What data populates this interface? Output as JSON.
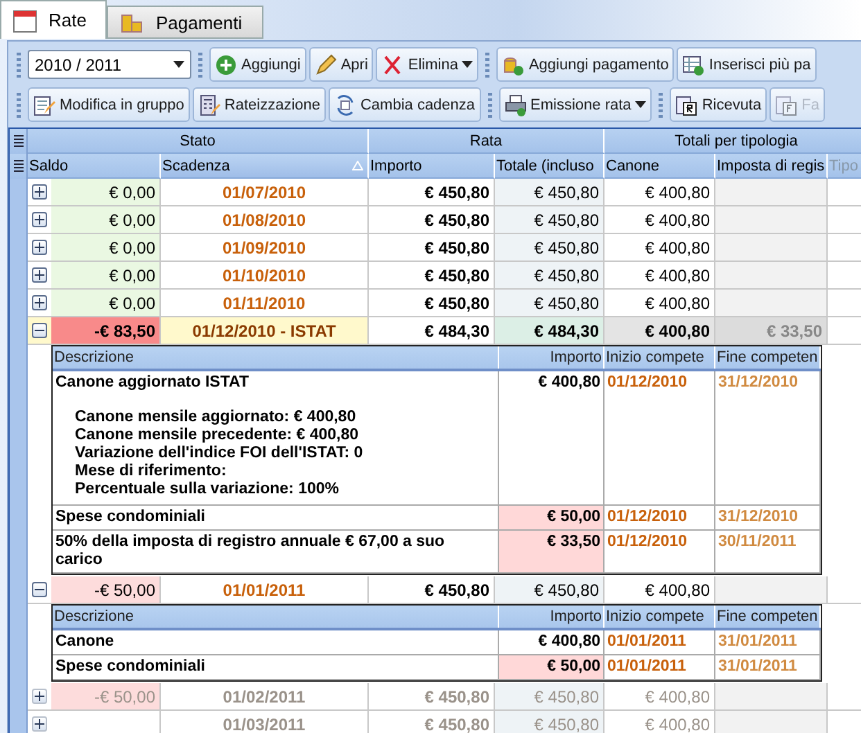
{
  "tabs": [
    {
      "label": "Rate",
      "selected": true
    },
    {
      "label": "Pagamenti",
      "selected": false
    }
  ],
  "toolbars": [
    [
      {
        "kind": "dropdown",
        "label": "2010 / 2011"
      },
      {
        "kind": "separator"
      },
      {
        "kind": "button",
        "label": "Aggiungi"
      },
      {
        "kind": "button",
        "label": "Apri"
      },
      {
        "kind": "split",
        "label": "Elimina"
      },
      {
        "kind": "separator"
      },
      {
        "kind": "button",
        "label": "Aggiungi pagamento"
      },
      {
        "kind": "button",
        "label": "Inserisci più pa"
      }
    ],
    [
      {
        "kind": "button",
        "label": "Modifica in gruppo"
      },
      {
        "kind": "button",
        "label": "Rateizzazione"
      },
      {
        "kind": "button",
        "label": "Cambia cadenza"
      },
      {
        "kind": "separator"
      },
      {
        "kind": "split",
        "label": "Emissione rata"
      },
      {
        "kind": "separator"
      },
      {
        "kind": "button",
        "label": "Ricevuta"
      },
      {
        "kind": "disabled",
        "label": "Fa"
      }
    ]
  ],
  "grid": {
    "groups": [
      {
        "label": "Stato",
        "columns": [
          {
            "label": "Saldo",
            "sorted": false
          },
          {
            "label": "Scadenza",
            "sorted": true
          }
        ]
      },
      {
        "label": "Rata",
        "columns": [
          {
            "label": "Importo",
            "sorted": false
          },
          {
            "label": "Totale (incluso",
            "sorted": false
          }
        ]
      },
      {
        "label": "Totali per tipologia",
        "columns": [
          {
            "label": "Canone",
            "sorted": false
          },
          {
            "label": "Imposta di regis",
            "sorted": false
          },
          {
            "label": "Tipo",
            "sorted": false
          }
        ]
      }
    ],
    "rows": [
      {
        "expanded": false,
        "selected": false,
        "dimmed": false,
        "color": "#eaf8e2",
        "saldo": "€ 0,00",
        "scadenza": "01/07/2010",
        "importo": "€ 450,80",
        "totale": "€ 450,80",
        "canone": "€ 400,80"
      },
      {
        "expanded": false,
        "selected": false,
        "dimmed": false,
        "color": "#eaf8e2",
        "saldo": "€ 0,00",
        "scadenza": "01/08/2010",
        "importo": "€ 450,80",
        "totale": "€ 450,80",
        "canone": "€ 400,80"
      },
      {
        "expanded": false,
        "selected": false,
        "dimmed": false,
        "color": "#eaf8e2",
        "saldo": "€ 0,00",
        "scadenza": "01/09/2010",
        "importo": "€ 450,80",
        "totale": "€ 450,80",
        "canone": "€ 400,80"
      },
      {
        "expanded": false,
        "selected": false,
        "dimmed": false,
        "color": "#eaf8e2",
        "saldo": "€ 0,00",
        "scadenza": "01/10/2010",
        "importo": "€ 450,80",
        "totale": "€ 450,80",
        "canone": "€ 400,80"
      },
      {
        "expanded": false,
        "selected": false,
        "dimmed": false,
        "color": "#eaf8e2",
        "saldo": "€ 0,00",
        "scadenza": "01/11/2010",
        "importo": "€ 450,80",
        "totale": "€ 450,80",
        "canone": "€ 400,80"
      },
      {
        "expanded": true,
        "selected": true,
        "dimmed": false,
        "color": "#f88a8a",
        "saldo": "-€ 83,50",
        "scadenza": "01/12/2010 - ISTAT",
        "importo": "€ 484,30",
        "totale": "€ 484,30",
        "canone": "€ 400,80",
        "imposta": "€ 33,50",
        "details": {
          "columns": [
            "Descrizione",
            "Importo",
            "Inizio compete",
            "Fine competen"
          ],
          "items": [
            {
              "descrizione": "Canone aggiornato ISTAT",
              "notes": [
                "Canone mensile aggiornato: € 400,80",
                "Canone mensile precedente: € 400,80",
                "Variazione dell'indice FOI dell'ISTAT: 0",
                "Mese di riferimento:",
                "Percentuale sulla variazione: 100%"
              ],
              "importo": "€ 400,80",
              "flagged": false,
              "inizio": "01/12/2010",
              "fine": "31/12/2010"
            },
            {
              "descrizione": "Spese condominiali",
              "importo": "€ 50,00",
              "flagged": true,
              "inizio": "01/12/2010",
              "fine": "31/12/2010"
            },
            {
              "descrizione": "50% della imposta di registro annuale € 67,00 a suo carico",
              "importo": "€ 33,50",
              "flagged": true,
              "inizio": "01/12/2010",
              "fine": "30/11/2011"
            }
          ]
        }
      },
      {
        "expanded": true,
        "selected": false,
        "dimmed": false,
        "color": "#fddcdc",
        "saldo": "-€ 50,00",
        "scadenza": "01/01/2011",
        "importo": "€ 450,80",
        "totale": "€ 450,80",
        "canone": "€ 400,80",
        "details": {
          "columns": [
            "Descrizione",
            "Importo",
            "Inizio compete",
            "Fine competen"
          ],
          "items": [
            {
              "descrizione": "Canone",
              "importo": "€ 400,80",
              "flagged": false,
              "inizio": "01/01/2011",
              "fine": "31/01/2011"
            },
            {
              "descrizione": "Spese condominiali",
              "importo": "€ 50,00",
              "flagged": true,
              "inizio": "01/01/2011",
              "fine": "31/01/2011"
            }
          ]
        }
      },
      {
        "expanded": false,
        "selected": false,
        "dimmed": true,
        "color": "#fddcdc",
        "saldo": "-€ 50,00",
        "scadenza": "01/02/2011",
        "importo": "€ 450,80",
        "totale": "€ 450,80",
        "canone": "€ 400,80"
      },
      {
        "expanded": false,
        "selected": false,
        "dimmed": true,
        "color": "#ffffff",
        "scadenza": "01/03/2011",
        "importo": "€ 450,80",
        "totale": "€ 450,80",
        "canone": "€ 400,80"
      }
    ]
  }
}
